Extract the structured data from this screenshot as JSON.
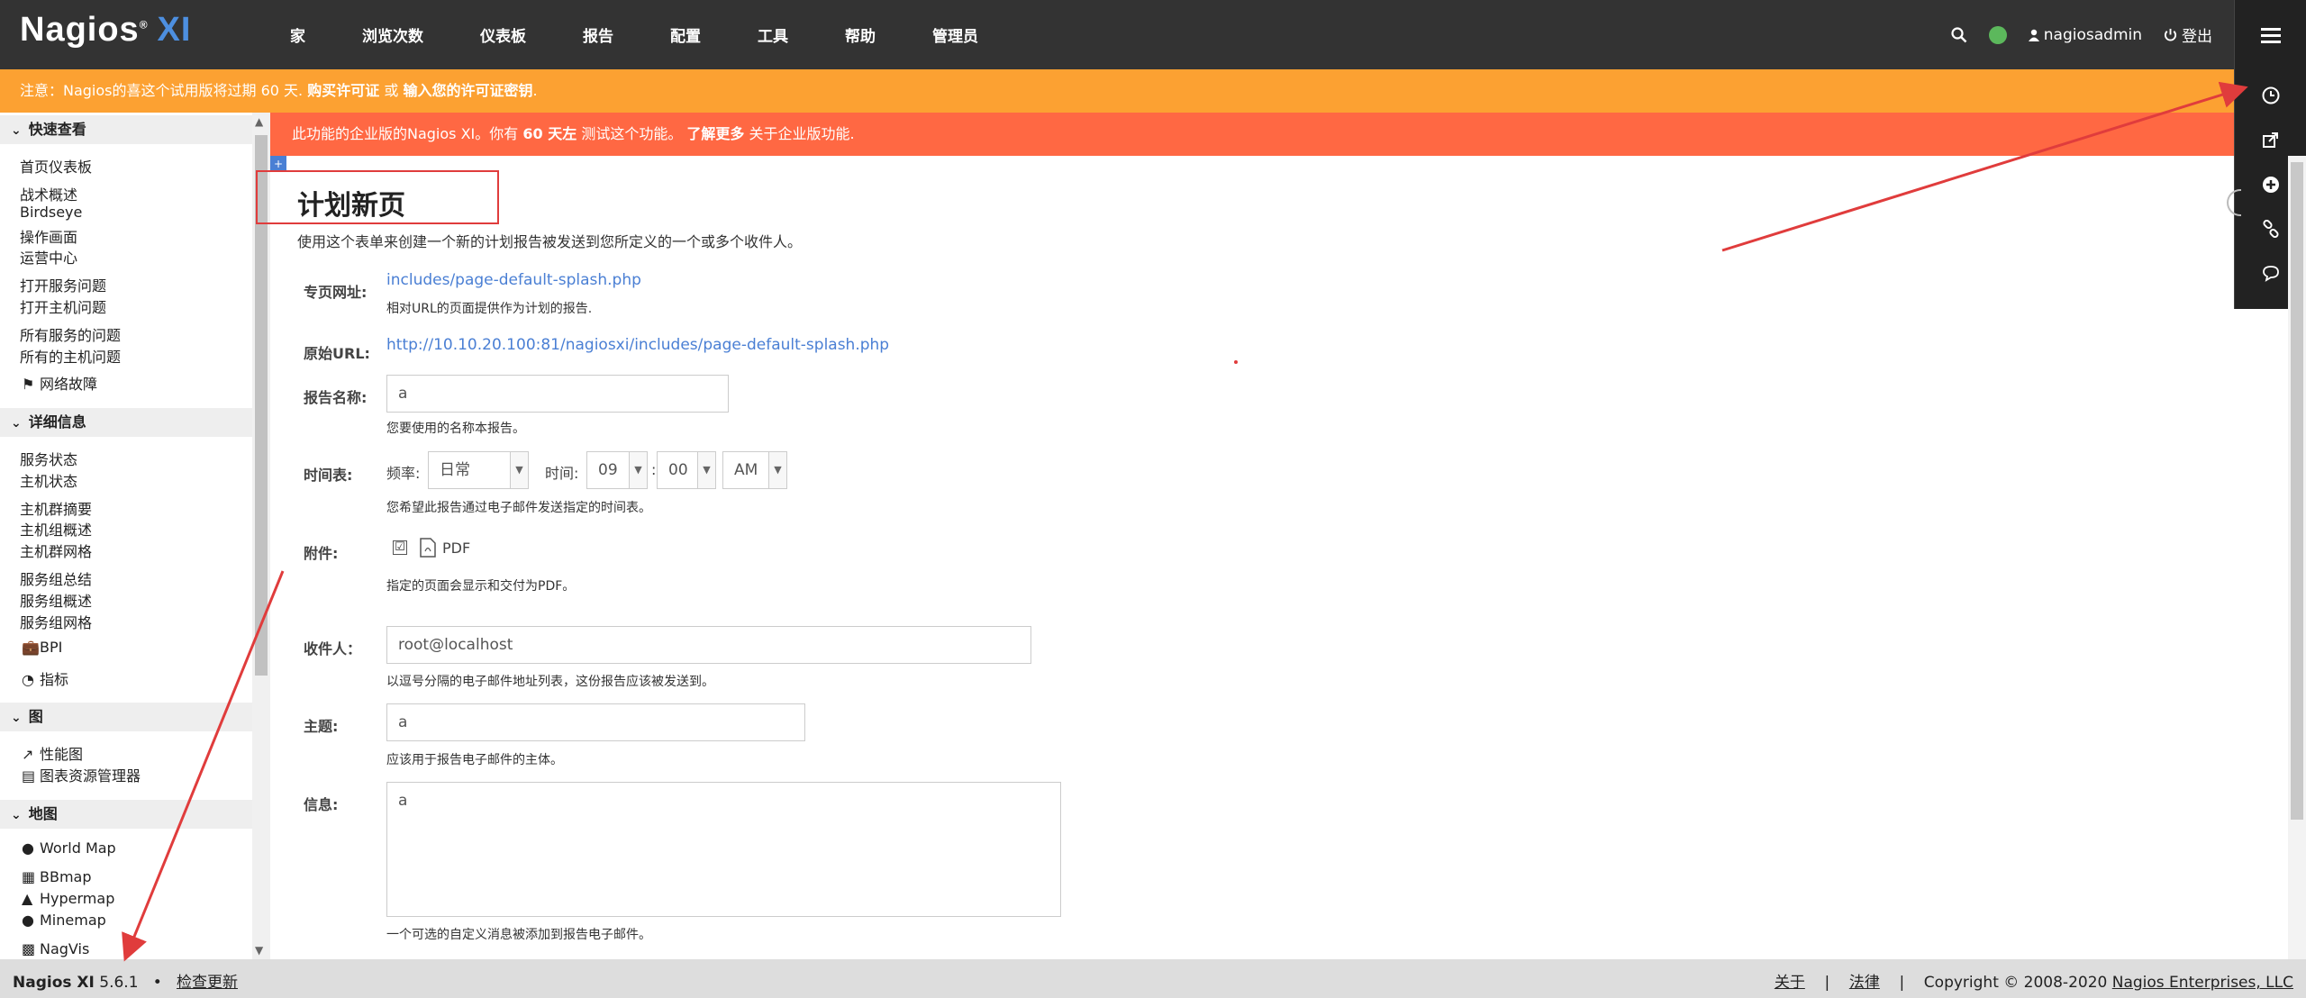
{
  "header": {
    "logo_text": "Nagios",
    "logo_xi": "XI",
    "nav": [
      "家",
      "浏览次数",
      "仪表板",
      "报告",
      "配置",
      "工具",
      "帮助",
      "管理员"
    ],
    "user": "nagiosadmin",
    "logout": "登出"
  },
  "banners": {
    "trial_prefix": "注意：Nagios的喜这个试用版将过期 60 天.",
    "trial_buy": "购买许可证",
    "trial_or": "或",
    "trial_enter": "输入您的许可证密钥",
    "trial_end": ".",
    "ent_prefix": "此功能的企业版的Nagios XI。你有",
    "ent_days": "60 天左",
    "ent_mid": "测试这个功能。",
    "ent_learn": "了解更多",
    "ent_end": "关于企业版功能."
  },
  "sidebar": {
    "sections": [
      {
        "title": "快速查看",
        "items": [
          "首页仪表板",
          "战术概述",
          "Birdseye",
          "操作画面",
          "运营中心",
          "打开服务问题",
          "打开主机问题",
          "所有服务的问题",
          "所有的主机问题",
          "网络故障"
        ]
      },
      {
        "title": "详细信息",
        "items": [
          "服务状态",
          "主机状态",
          "主机群摘要",
          "主机组概述",
          "主机群网格",
          "服务组总结",
          "服务组概述",
          "服务组网格",
          "BPI",
          "指标"
        ]
      },
      {
        "title": "图",
        "items": [
          "性能图",
          "图表资源管理器"
        ]
      },
      {
        "title": "地图",
        "items": [
          "World Map",
          "BBmap",
          "Hypermap",
          "Minemap",
          "NagVis"
        ]
      }
    ]
  },
  "form": {
    "title": "计划新页",
    "description": "使用这个表单来创建一个新的计划报告被发送到您所定义的一个或多个收件人。",
    "page_url_label": "专页网址:",
    "page_url_value": "includes/page-default-splash.php",
    "page_url_hint": "相对URL的页面提供作为计划的报告.",
    "orig_url_label": "原始URL:",
    "orig_url_value": "http://10.10.20.100:81/nagiosxi/includes/page-default-splash.php",
    "report_name_label": "报告名称:",
    "report_name_value": "a",
    "report_name_hint": "您要使用的名称本报告。",
    "schedule_label": "时间表:",
    "freq_label": "频率:",
    "freq_value": "日常",
    "time_label": "时间:",
    "hour_value": "09",
    "colon": ":",
    "minute_value": "00",
    "ampm_value": "AM",
    "schedule_hint": "您希望此报告通过电子邮件发送指定的时间表。",
    "attach_label": "附件:",
    "attach_check": "☑",
    "attach_pdf": "PDF",
    "attach_hint": "指定的页面会显示和交付为PDF。",
    "recipients_label": "收件人：",
    "recipients_value": "root@localhost",
    "recipients_hint": "以逗号分隔的电子邮件地址列表，这份报告应该被发送到。",
    "subject_label": "主题:",
    "subject_value": "a",
    "subject_hint": "应该用于报告电子邮件的主体。",
    "message_label": "信息:",
    "message_value": "a",
    "message_hint": "一个可选的自定义消息被添加到报告电子邮件。"
  },
  "footer": {
    "product": "Nagios XI",
    "version": "5.6.1",
    "bullet": "•",
    "check_updates": "检查更新",
    "about": "关于",
    "sep": "|",
    "legal": "法律",
    "copyright_prefix": "Copyright © 2008-2020",
    "company": "Nagios Enterprises, LLC"
  },
  "colors": {
    "topbar": "#333333",
    "trial_banner": "#fca132",
    "enterprise_banner": "#ff6843",
    "link": "#4a7fd4",
    "annotation": "#e03c3c"
  }
}
